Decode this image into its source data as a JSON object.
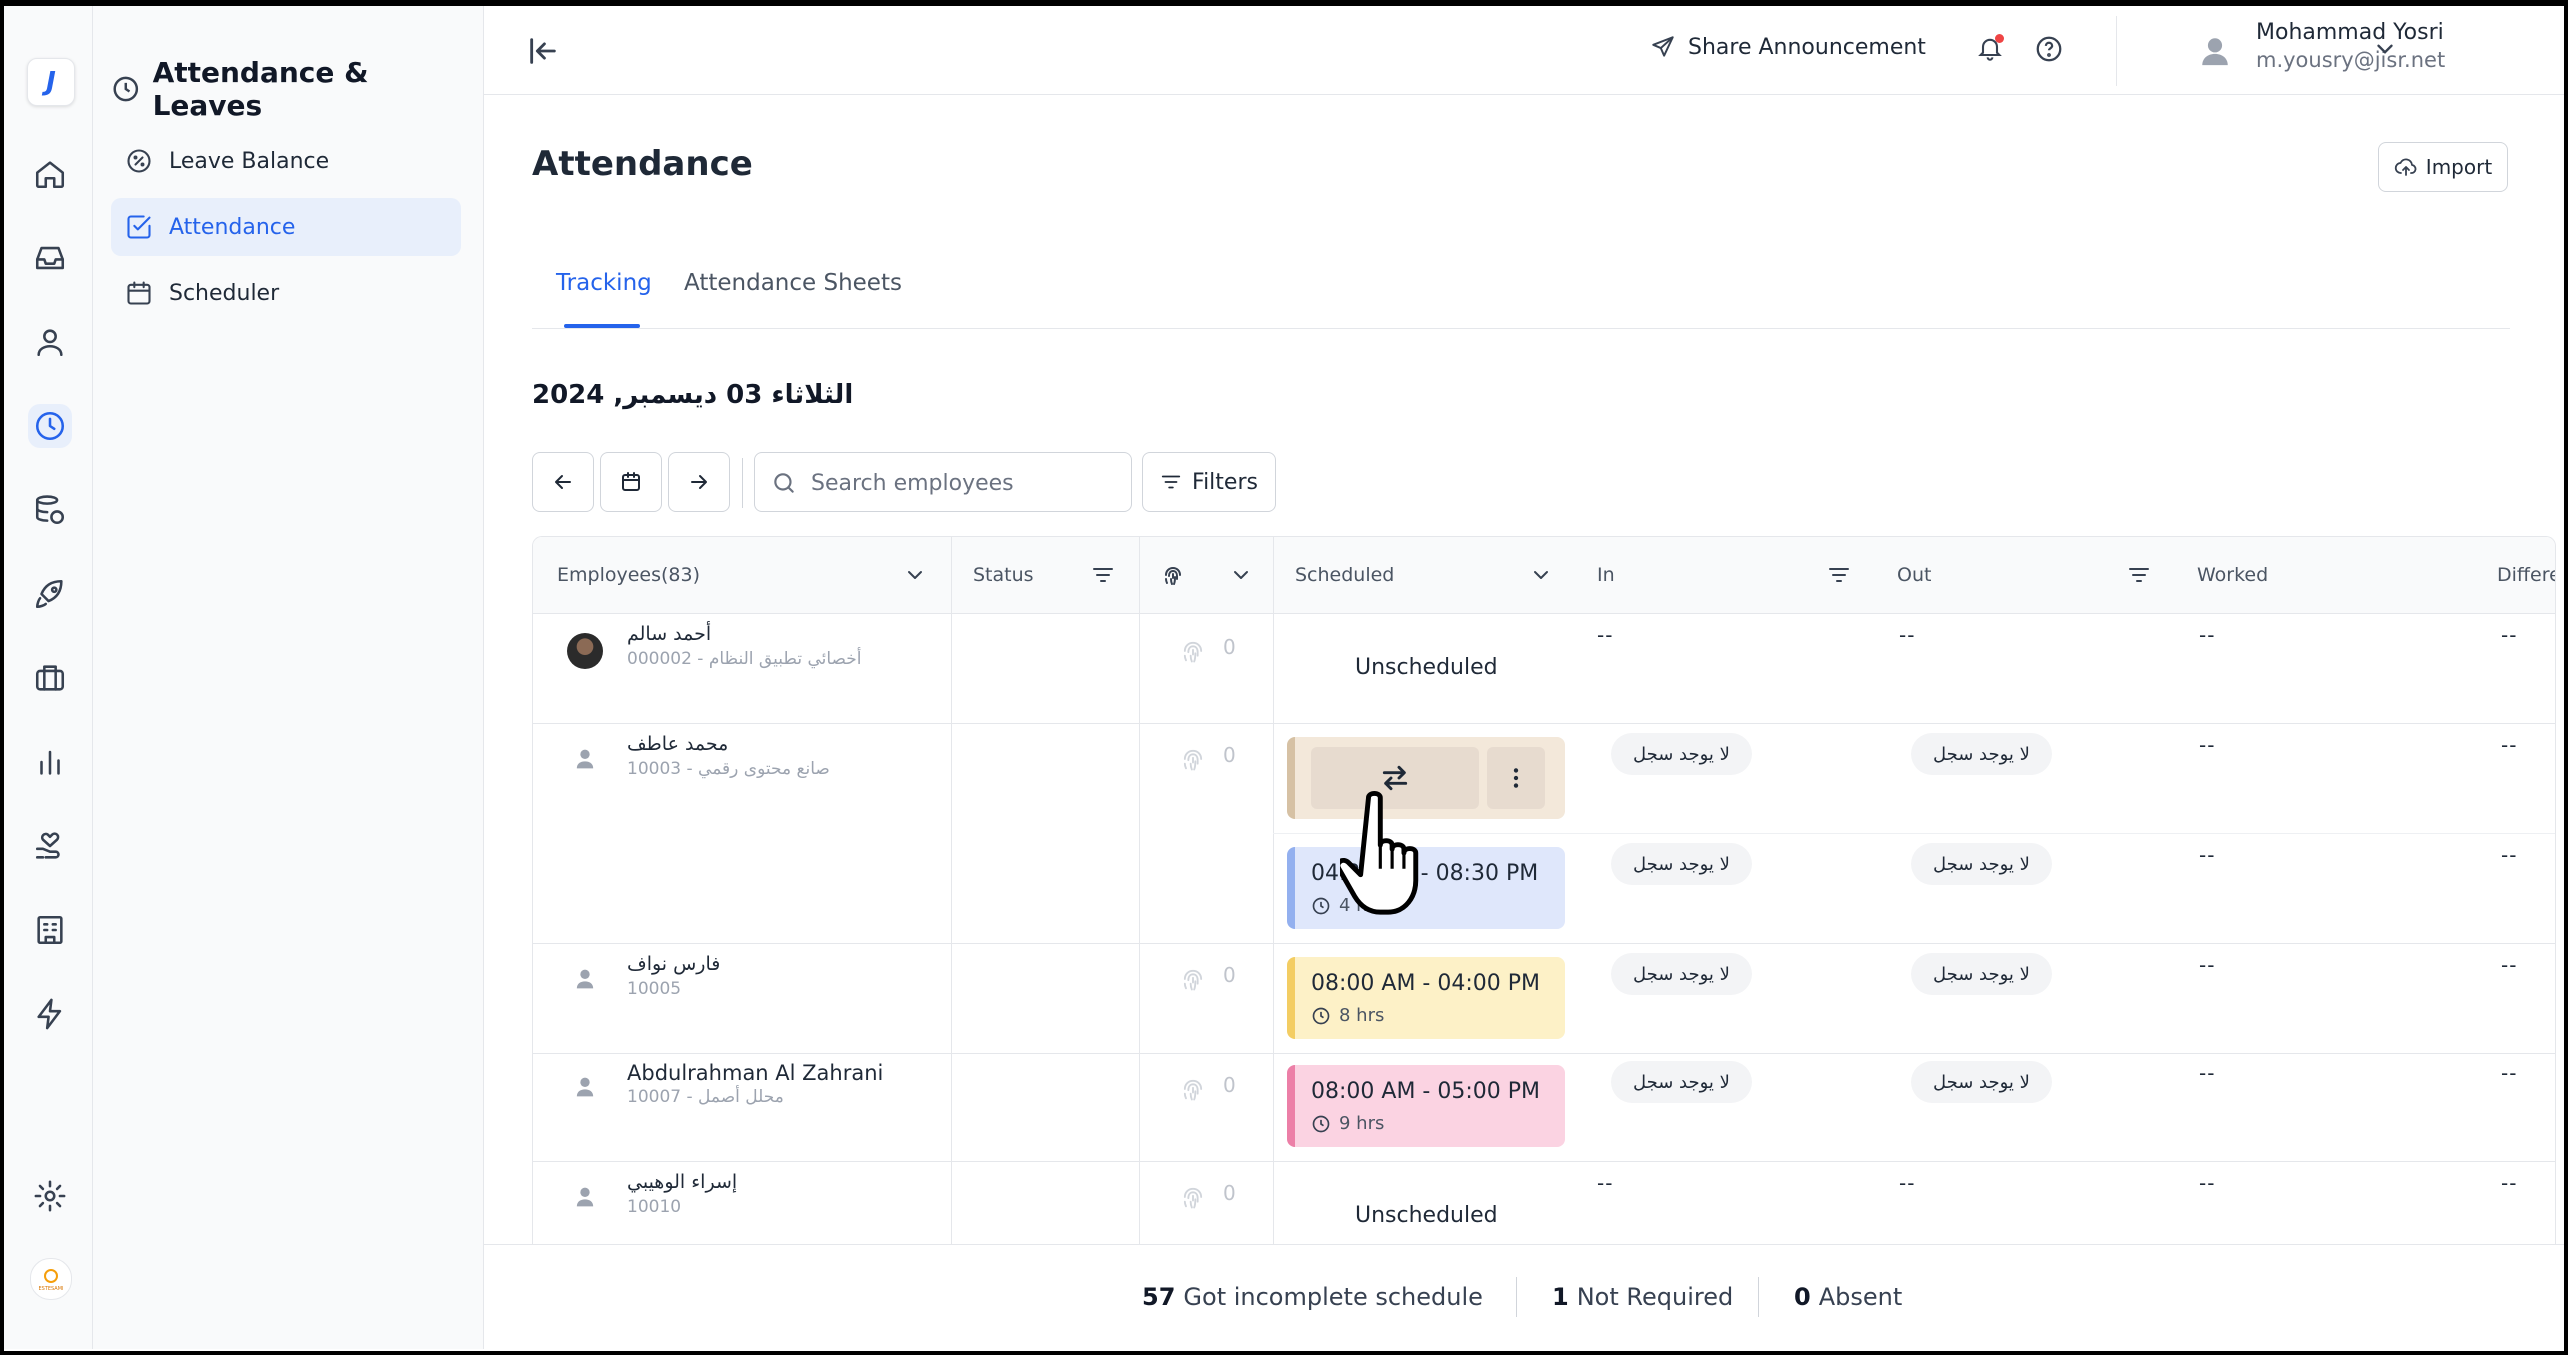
{
  "rail": {
    "logo_letter": "J",
    "brand_mark_text": "ESTESAMI",
    "items": [
      "home-icon",
      "inbox-icon",
      "user-icon",
      "clock-icon",
      "database-icon",
      "rocket-icon",
      "briefcase-icon",
      "chart-icon",
      "hand-heart-icon",
      "building-icon",
      "lightning-icon",
      "gear-icon"
    ],
    "active_item": "clock-icon"
  },
  "sidebar": {
    "title": "Attendance & Leaves",
    "items": [
      {
        "label": "Leave Balance",
        "icon": "percent-badge-icon"
      },
      {
        "label": "Attendance",
        "icon": "check-square-icon",
        "active": true
      },
      {
        "label": "Scheduler",
        "icon": "calendar-icon"
      }
    ]
  },
  "topbar": {
    "share_label": "Share Announcement",
    "user_name": "Mohammad Yosri",
    "user_email": "m.yousry@jisr.net",
    "notification_dot_color": "#ef4444"
  },
  "page": {
    "title": "Attendance",
    "import_label": "Import",
    "tabs": [
      {
        "label": "Tracking",
        "active": true
      },
      {
        "label": "Attendance Sheets"
      }
    ],
    "date_heading": "الثلاثاء 03 ديسمبر, 2024"
  },
  "toolbar": {
    "search_placeholder": "Search employees",
    "search_value": "",
    "filters_label": "Filters"
  },
  "table": {
    "columns": {
      "employees": "Employees(83)",
      "status": "Status",
      "scheduled": "Scheduled",
      "in": "In",
      "out": "Out",
      "worked": "Worked",
      "difference": "Differe"
    },
    "empty": "--",
    "unscheduled": "Unscheduled",
    "no_record": "لا يوجد سجل",
    "rows": [
      {
        "name": "أحمد سالم",
        "sub": "000002 - أخصائي تطبيق النظام",
        "punches": "0"
      },
      {
        "name": "محمد عاطف",
        "sub": "10003 - صانع محتوى رقمي",
        "punches": "0",
        "shift_time": "04:30 PM - 08:30 PM",
        "shift_duration": "4 hrs"
      },
      {
        "name": "فارس نواف",
        "sub": "10005",
        "punches": "0",
        "shift_time": "08:00 AM - 04:00 PM",
        "shift_duration": "8 hrs"
      },
      {
        "name": "Abdulrahman Al Zahrani",
        "sub": "10007 - محلل أصمل",
        "punches": "0",
        "shift_time": "08:00 AM - 05:00 PM",
        "shift_duration": "9 hrs"
      },
      {
        "name": "إسراء الوهيبي",
        "sub": "10010",
        "punches": "0"
      }
    ]
  },
  "footer": {
    "incomplete_count": "57",
    "incomplete_label": "Got incomplete schedule",
    "not_required_count": "1",
    "not_required_label": "Not Required",
    "absent_count": "0",
    "absent_label": "Absent"
  }
}
